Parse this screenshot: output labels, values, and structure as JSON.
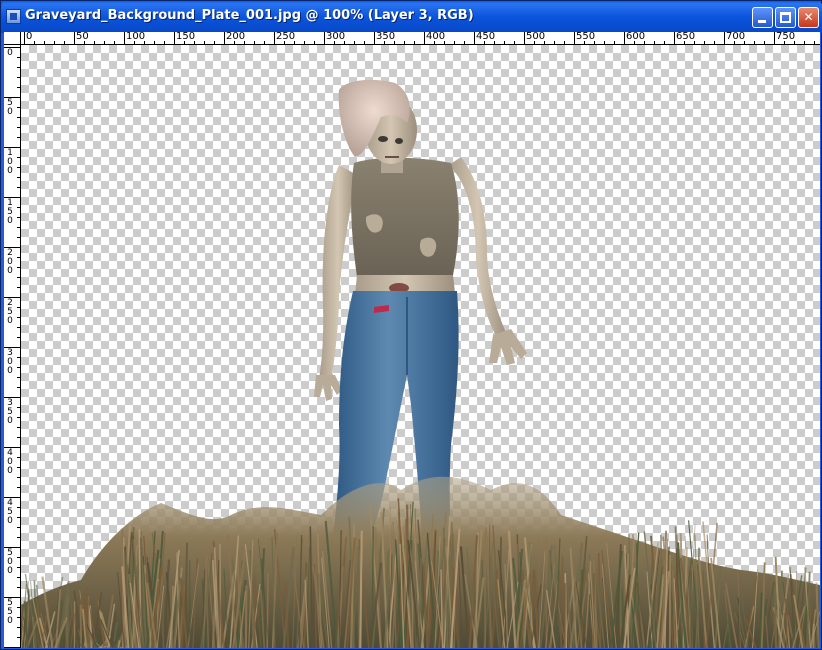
{
  "window": {
    "title": "Graveyard_Background_Plate_001.jpg @ 100% (Layer 3, RGB)",
    "buttons": {
      "minimize": "minimize",
      "maximize": "maximize",
      "close": "✕"
    }
  },
  "ruler": {
    "horizontal": [
      "0",
      "50",
      "100",
      "150",
      "200",
      "250",
      "300",
      "350",
      "400",
      "450",
      "500",
      "550",
      "600",
      "650",
      "700",
      "750"
    ],
    "vertical": [
      "0",
      "50",
      "100",
      "150",
      "200",
      "250",
      "300",
      "350",
      "400",
      "450",
      "500",
      "550"
    ]
  },
  "colors": {
    "titlebar": "#0b54dd",
    "checker_dark": "#cccccc",
    "checker_light": "#ffffff",
    "jeans": "#3e6d98",
    "grass": "#7a6a4c"
  }
}
